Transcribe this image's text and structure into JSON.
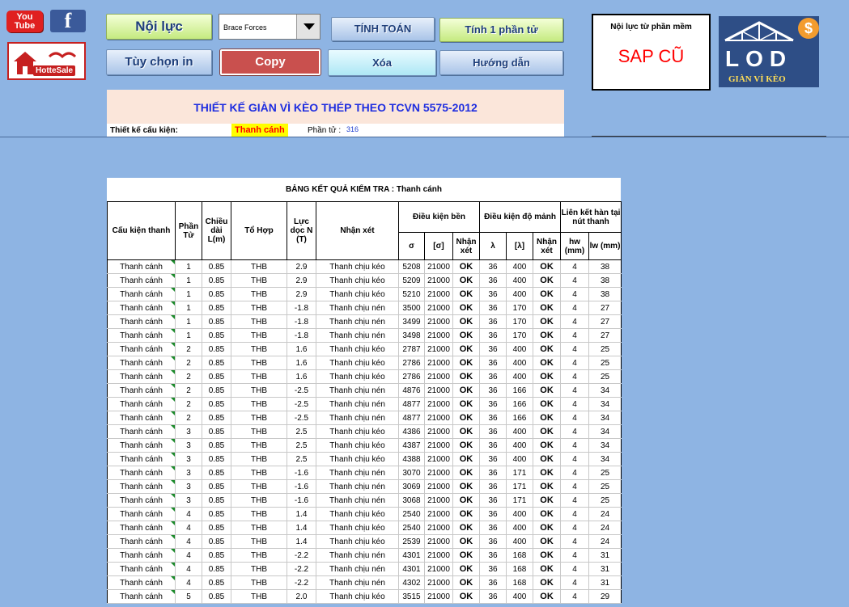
{
  "social": {
    "youtube_label": "You Tube",
    "facebook_label": "f",
    "housesale_label": "HotteSale"
  },
  "buttons": {
    "noi_luc": "Nội lực",
    "tuy_chon_in": "Tùy chọn in",
    "copy": "Copy",
    "tinh_toan": "TÍNH TOÁN",
    "xoa": "Xóa",
    "tinh_1_phan_tu": "Tính 1 phần tử",
    "huong_dan": "Hướng dẫn"
  },
  "dropdown": {
    "selected": "Brace Forces"
  },
  "sap_box": {
    "label": "Nội lực từ phần mềm",
    "value": "SAP CŨ"
  },
  "logo": {
    "letters": "LOD",
    "subtitle": "GIÀN VÌ KÈO",
    "badge": "$"
  },
  "title": "THIẾT KẾ GIÀN VÌ KÈO THÉP THEO TCVN 5575-2012",
  "info": {
    "label": "Thiết kế cấu kiện:",
    "value": "Thanh cánh",
    "element_label": "Phần tử :",
    "element_value": "316"
  },
  "results": {
    "title": "BẢNG KẾT QUẢ KIỂM TRA : Thanh cánh",
    "headers": {
      "cau_kien": "Cấu kiện thanh",
      "phan_tu": "Phần Tử",
      "chieu_dai": "Chiều dài L(m)",
      "to_hop": "Tổ Hợp",
      "luc_doc": "Lực dọc N (T)",
      "nhan_xet": "Nhận xét",
      "dieu_kien_ben": "Điều kiện bền",
      "sigma": "σ",
      "sigma_allow": "[σ]",
      "nhan_xet_ben": "Nhận xét",
      "dieu_kien_do_manh": "Điều kiện độ mảnh",
      "lambda": "λ",
      "lambda_allow": "[λ]",
      "nhan_xet_manh": "Nhận xét",
      "lien_ket_han": "Liên kết hàn tại nút thanh",
      "hw": "hw (mm)",
      "lw": "lw (mm)"
    },
    "rows": [
      [
        "Thanh cánh",
        "1",
        "0.85",
        "THB",
        "2.9",
        "Thanh chịu kéo",
        "5208",
        "21000",
        "OK",
        "36",
        "400",
        "OK",
        "4",
        "38"
      ],
      [
        "Thanh cánh",
        "1",
        "0.85",
        "THB",
        "2.9",
        "Thanh chịu kéo",
        "5209",
        "21000",
        "OK",
        "36",
        "400",
        "OK",
        "4",
        "38"
      ],
      [
        "Thanh cánh",
        "1",
        "0.85",
        "THB",
        "2.9",
        "Thanh chịu kéo",
        "5210",
        "21000",
        "OK",
        "36",
        "400",
        "OK",
        "4",
        "38"
      ],
      [
        "Thanh cánh",
        "1",
        "0.85",
        "THB",
        "-1.8",
        "Thanh chịu nén",
        "3500",
        "21000",
        "OK",
        "36",
        "170",
        "OK",
        "4",
        "27"
      ],
      [
        "Thanh cánh",
        "1",
        "0.85",
        "THB",
        "-1.8",
        "Thanh chịu nén",
        "3499",
        "21000",
        "OK",
        "36",
        "170",
        "OK",
        "4",
        "27"
      ],
      [
        "Thanh cánh",
        "1",
        "0.85",
        "THB",
        "-1.8",
        "Thanh chịu nén",
        "3498",
        "21000",
        "OK",
        "36",
        "170",
        "OK",
        "4",
        "27"
      ],
      [
        "Thanh cánh",
        "2",
        "0.85",
        "THB",
        "1.6",
        "Thanh chịu kéo",
        "2787",
        "21000",
        "OK",
        "36",
        "400",
        "OK",
        "4",
        "25"
      ],
      [
        "Thanh cánh",
        "2",
        "0.85",
        "THB",
        "1.6",
        "Thanh chịu kéo",
        "2786",
        "21000",
        "OK",
        "36",
        "400",
        "OK",
        "4",
        "25"
      ],
      [
        "Thanh cánh",
        "2",
        "0.85",
        "THB",
        "1.6",
        "Thanh chịu kéo",
        "2786",
        "21000",
        "OK",
        "36",
        "400",
        "OK",
        "4",
        "25"
      ],
      [
        "Thanh cánh",
        "2",
        "0.85",
        "THB",
        "-2.5",
        "Thanh chịu nén",
        "4876",
        "21000",
        "OK",
        "36",
        "166",
        "OK",
        "4",
        "34"
      ],
      [
        "Thanh cánh",
        "2",
        "0.85",
        "THB",
        "-2.5",
        "Thanh chịu nén",
        "4877",
        "21000",
        "OK",
        "36",
        "166",
        "OK",
        "4",
        "34"
      ],
      [
        "Thanh cánh",
        "2",
        "0.85",
        "THB",
        "-2.5",
        "Thanh chịu nén",
        "4877",
        "21000",
        "OK",
        "36",
        "166",
        "OK",
        "4",
        "34"
      ],
      [
        "Thanh cánh",
        "3",
        "0.85",
        "THB",
        "2.5",
        "Thanh chịu kéo",
        "4386",
        "21000",
        "OK",
        "36",
        "400",
        "OK",
        "4",
        "34"
      ],
      [
        "Thanh cánh",
        "3",
        "0.85",
        "THB",
        "2.5",
        "Thanh chịu kéo",
        "4387",
        "21000",
        "OK",
        "36",
        "400",
        "OK",
        "4",
        "34"
      ],
      [
        "Thanh cánh",
        "3",
        "0.85",
        "THB",
        "2.5",
        "Thanh chịu kéo",
        "4388",
        "21000",
        "OK",
        "36",
        "400",
        "OK",
        "4",
        "34"
      ],
      [
        "Thanh cánh",
        "3",
        "0.85",
        "THB",
        "-1.6",
        "Thanh chịu nén",
        "3070",
        "21000",
        "OK",
        "36",
        "171",
        "OK",
        "4",
        "25"
      ],
      [
        "Thanh cánh",
        "3",
        "0.85",
        "THB",
        "-1.6",
        "Thanh chịu nén",
        "3069",
        "21000",
        "OK",
        "36",
        "171",
        "OK",
        "4",
        "25"
      ],
      [
        "Thanh cánh",
        "3",
        "0.85",
        "THB",
        "-1.6",
        "Thanh chịu nén",
        "3068",
        "21000",
        "OK",
        "36",
        "171",
        "OK",
        "4",
        "25"
      ],
      [
        "Thanh cánh",
        "4",
        "0.85",
        "THB",
        "1.4",
        "Thanh chịu kéo",
        "2540",
        "21000",
        "OK",
        "36",
        "400",
        "OK",
        "4",
        "24"
      ],
      [
        "Thanh cánh",
        "4",
        "0.85",
        "THB",
        "1.4",
        "Thanh chịu kéo",
        "2540",
        "21000",
        "OK",
        "36",
        "400",
        "OK",
        "4",
        "24"
      ],
      [
        "Thanh cánh",
        "4",
        "0.85",
        "THB",
        "1.4",
        "Thanh chịu kéo",
        "2539",
        "21000",
        "OK",
        "36",
        "400",
        "OK",
        "4",
        "24"
      ],
      [
        "Thanh cánh",
        "4",
        "0.85",
        "THB",
        "-2.2",
        "Thanh chịu nén",
        "4301",
        "21000",
        "OK",
        "36",
        "168",
        "OK",
        "4",
        "31"
      ],
      [
        "Thanh cánh",
        "4",
        "0.85",
        "THB",
        "-2.2",
        "Thanh chịu nén",
        "4301",
        "21000",
        "OK",
        "36",
        "168",
        "OK",
        "4",
        "31"
      ],
      [
        "Thanh cánh",
        "4",
        "0.85",
        "THB",
        "-2.2",
        "Thanh chịu nén",
        "4302",
        "21000",
        "OK",
        "36",
        "168",
        "OK",
        "4",
        "31"
      ],
      [
        "Thanh cánh",
        "5",
        "0.85",
        "THB",
        "2.0",
        "Thanh chịu kéo",
        "3515",
        "21000",
        "OK",
        "36",
        "400",
        "OK",
        "4",
        "29"
      ]
    ]
  }
}
